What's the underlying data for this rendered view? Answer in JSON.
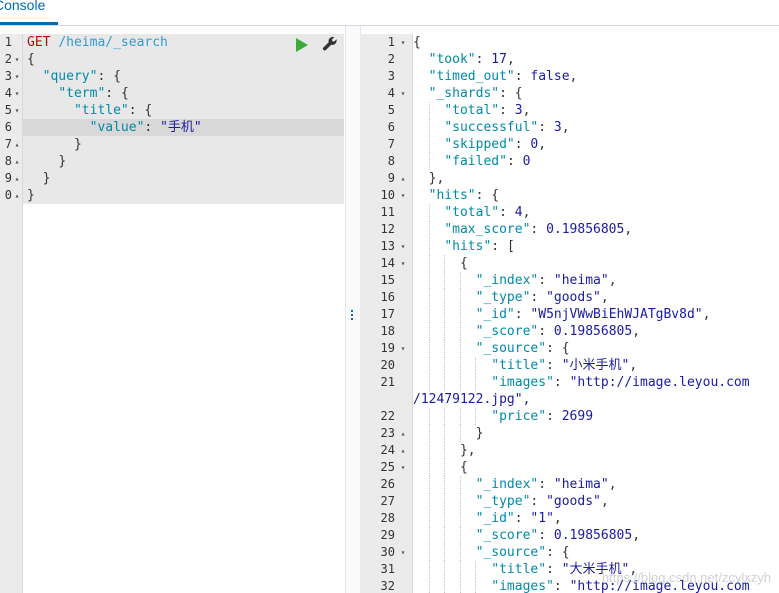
{
  "tab": {
    "label": "Console"
  },
  "request": {
    "method": "GET",
    "path": "/heima/_search",
    "lines": [
      "{",
      "  \"query\": {",
      "    \"term\": {",
      "      \"title\": {",
      "        \"value\": \"手机\"",
      "      }",
      "    }",
      "  }",
      "}"
    ],
    "line_numbers": [
      "1",
      "2",
      "3",
      "4",
      "5",
      "6",
      "7",
      "8",
      "9",
      "0"
    ]
  },
  "response": {
    "line_numbers": [
      "1",
      "2",
      "3",
      "4",
      "5",
      "6",
      "7",
      "8",
      "9",
      "10",
      "11",
      "12",
      "13",
      "14",
      "15",
      "16",
      "17",
      "18",
      "19",
      "20",
      "21",
      "",
      "22",
      "23",
      "24",
      "25",
      "26",
      "27",
      "28",
      "29",
      "30",
      "31",
      "32"
    ],
    "lines": [
      "{",
      "  \"took\": 17,",
      "  \"timed_out\": false,",
      "  \"_shards\": {",
      "    \"total\": 3,",
      "    \"successful\": 3,",
      "    \"skipped\": 0,",
      "    \"failed\": 0",
      "  },",
      "  \"hits\": {",
      "    \"total\": 4,",
      "    \"max_score\": 0.19856805,",
      "    \"hits\": [",
      "      {",
      "        \"_index\": \"heima\",",
      "        \"_type\": \"goods\",",
      "        \"_id\": \"W5njVWwBiEhWJATgBv8d\",",
      "        \"_score\": 0.19856805,",
      "        \"_source\": {",
      "          \"title\": \"小米手机\",",
      "          \"images\": \"http://image.leyou.com",
      "/12479122.jpg\",",
      "          \"price\": 2699",
      "        }",
      "      },",
      "      {",
      "        \"_index\": \"heima\",",
      "        \"_type\": \"goods\",",
      "        \"_id\": \"1\",",
      "        \"_score\": 0.19856805,",
      "        \"_source\": {",
      "          \"title\": \"大米手机\",",
      "          \"images\": \"http://image.leyou.com"
    ]
  },
  "watermark": "https://blog.csdn.net/zcylxzyh",
  "colors": {
    "accent": "#006bb4",
    "run": "#3caa3c",
    "method": "#c5060b",
    "key": "#008aa8",
    "value": "#1a1aa6"
  }
}
